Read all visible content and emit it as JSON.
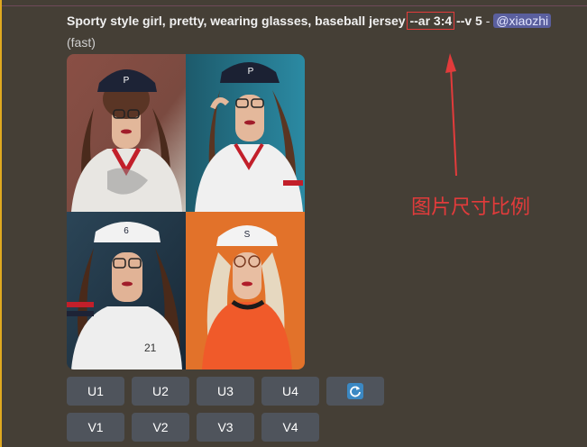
{
  "message": {
    "prompt_main": "Sporty style girl, pretty, wearing glasses, baseball jersey ",
    "aspect_param": "--ar 3:4",
    "version_param": " --v 5",
    "separator": " - ",
    "mention": "@xiaozhi",
    "speed": "(fast)"
  },
  "images": [
    {
      "name": "image-1",
      "cap_letter": "P"
    },
    {
      "name": "image-2",
      "cap_letter": "P"
    },
    {
      "name": "image-3",
      "cap_letter": "6"
    },
    {
      "name": "image-4",
      "cap_letter": "S"
    }
  ],
  "buttons": {
    "upscale": [
      "U1",
      "U2",
      "U3",
      "U4"
    ],
    "variation": [
      "V1",
      "V2",
      "V3",
      "V4"
    ],
    "reroll_icon": "refresh-icon"
  },
  "annotation": {
    "text": "图片尺寸比例",
    "color": "#e23b3b"
  },
  "colors": {
    "background": "#453f36",
    "button": "#4f545c",
    "mention_bg": "#5a5f9e",
    "accent_bar": "#e0a91f"
  }
}
